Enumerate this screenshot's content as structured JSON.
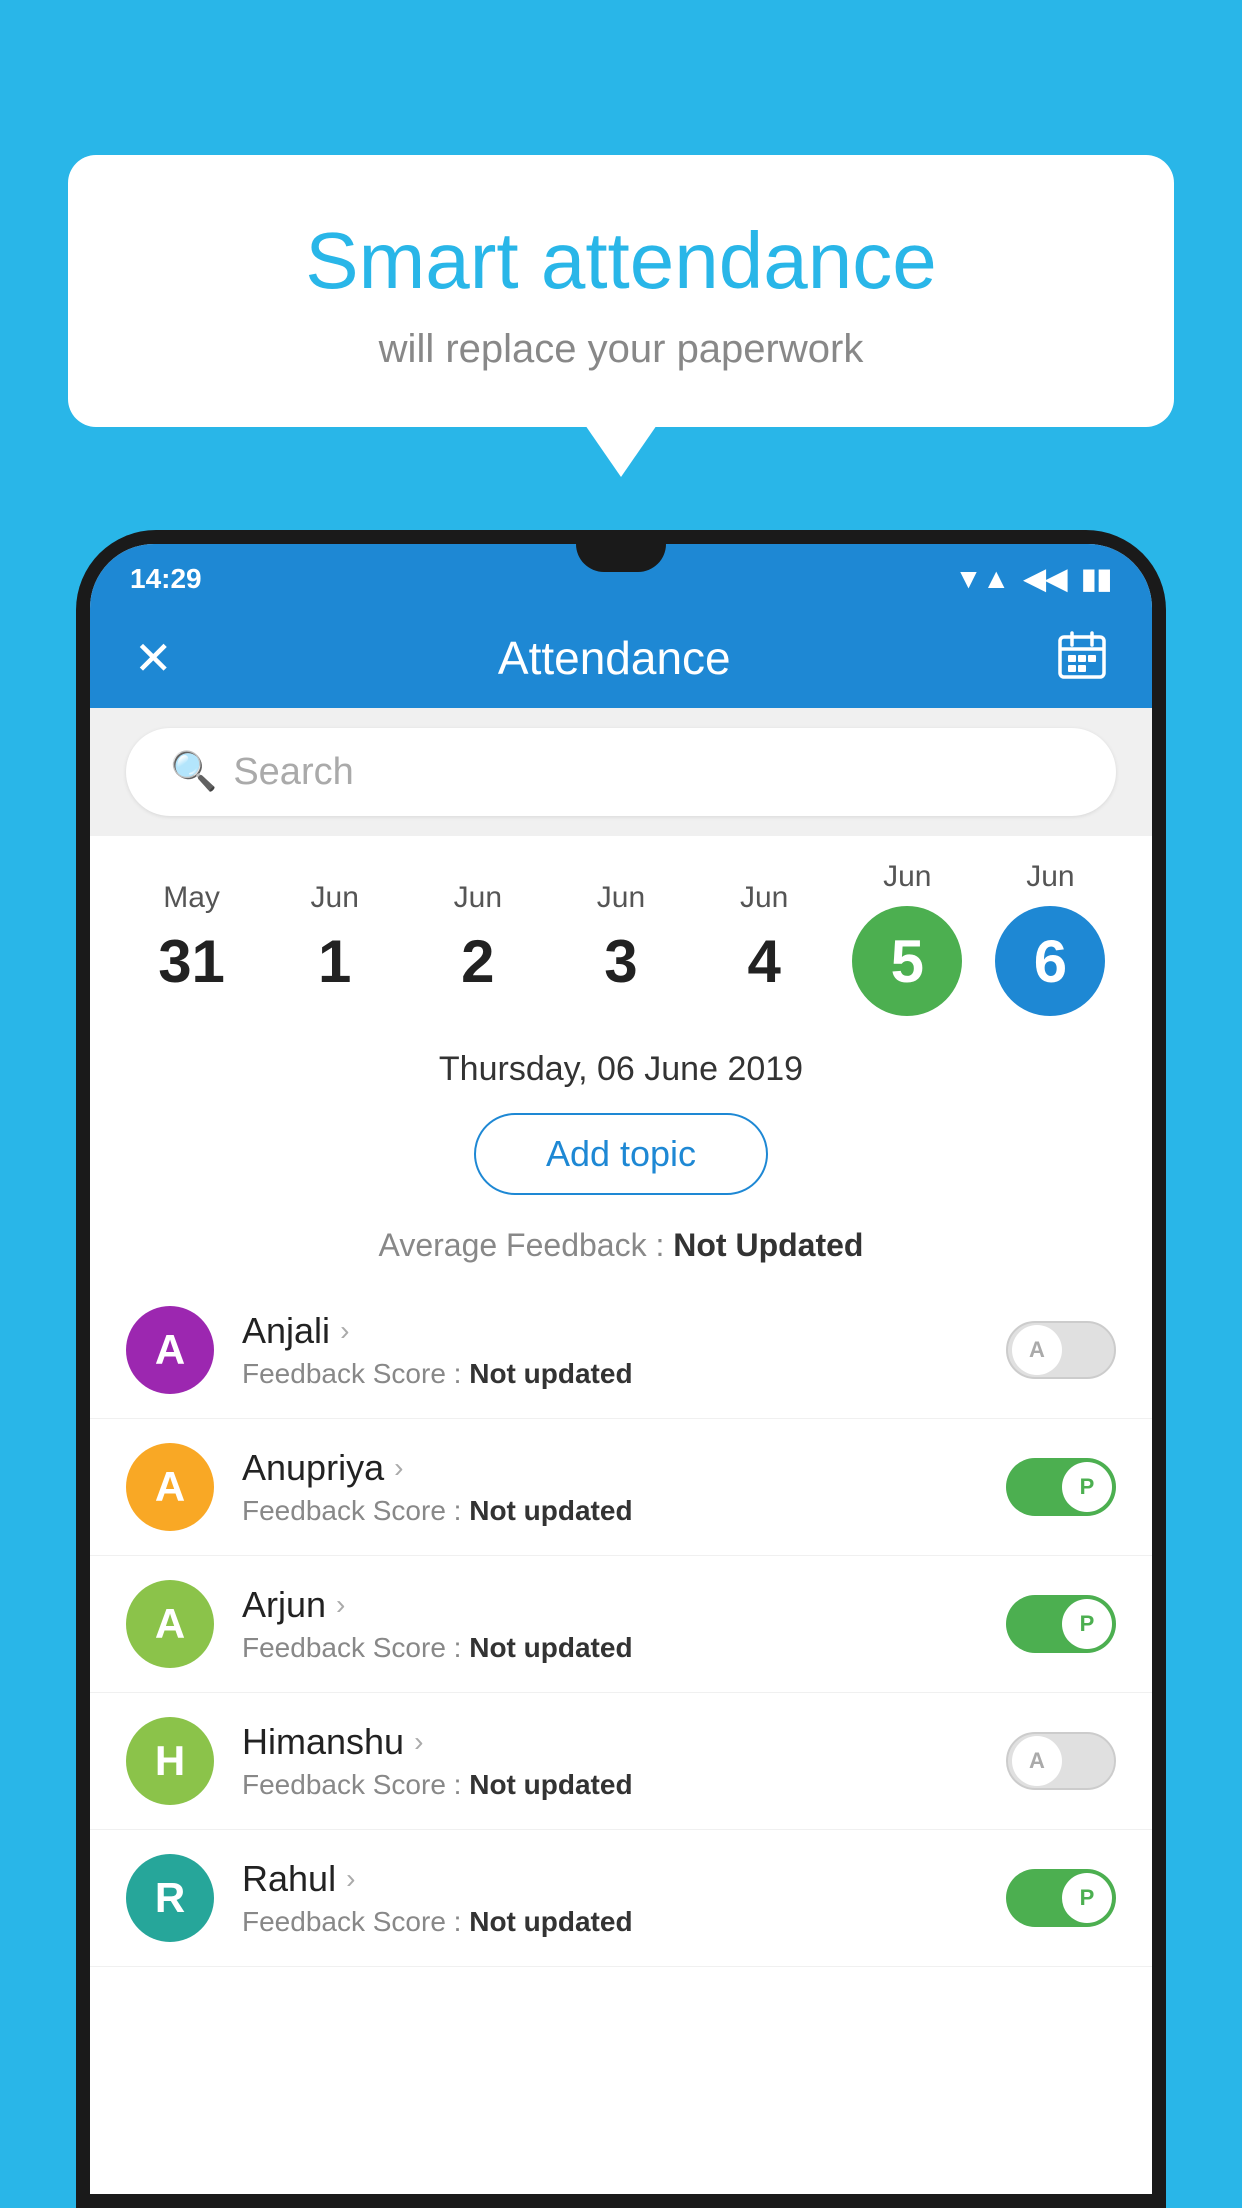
{
  "background_color": "#29b6e8",
  "bubble": {
    "title": "Smart attendance",
    "subtitle": "will replace your paperwork"
  },
  "status_bar": {
    "time": "14:29",
    "wifi": "▼",
    "signal": "◀",
    "battery": "▮"
  },
  "header": {
    "title": "Attendance",
    "close_label": "✕",
    "calendar_label": "📅"
  },
  "search": {
    "placeholder": "Search"
  },
  "calendar": {
    "dates": [
      {
        "month": "May",
        "day": "31",
        "type": "normal"
      },
      {
        "month": "Jun",
        "day": "1",
        "type": "normal"
      },
      {
        "month": "Jun",
        "day": "2",
        "type": "normal"
      },
      {
        "month": "Jun",
        "day": "3",
        "type": "normal"
      },
      {
        "month": "Jun",
        "day": "4",
        "type": "normal"
      },
      {
        "month": "Jun",
        "day": "5",
        "type": "today"
      },
      {
        "month": "Jun",
        "day": "6",
        "type": "selected"
      }
    ]
  },
  "selected_date": "Thursday, 06 June 2019",
  "add_topic_label": "Add topic",
  "average_feedback": {
    "label": "Average Feedback :",
    "value": "Not Updated"
  },
  "students": [
    {
      "name": "Anjali",
      "avatar_letter": "A",
      "avatar_color": "#9c27b0",
      "feedback_label": "Feedback Score :",
      "feedback_value": "Not updated",
      "attendance": "absent",
      "toggle_letter": "A"
    },
    {
      "name": "Anupriya",
      "avatar_letter": "A",
      "avatar_color": "#f9a825",
      "feedback_label": "Feedback Score :",
      "feedback_value": "Not updated",
      "attendance": "present",
      "toggle_letter": "P"
    },
    {
      "name": "Arjun",
      "avatar_letter": "A",
      "avatar_color": "#8bc34a",
      "feedback_label": "Feedback Score :",
      "feedback_value": "Not updated",
      "attendance": "present",
      "toggle_letter": "P"
    },
    {
      "name": "Himanshu",
      "avatar_letter": "H",
      "avatar_color": "#8bc34a",
      "feedback_label": "Feedback Score :",
      "feedback_value": "Not updated",
      "attendance": "absent",
      "toggle_letter": "A"
    },
    {
      "name": "Rahul",
      "avatar_letter": "R",
      "avatar_color": "#26a69a",
      "feedback_label": "Feedback Score :",
      "feedback_value": "Not updated",
      "attendance": "present",
      "toggle_letter": "P"
    }
  ]
}
